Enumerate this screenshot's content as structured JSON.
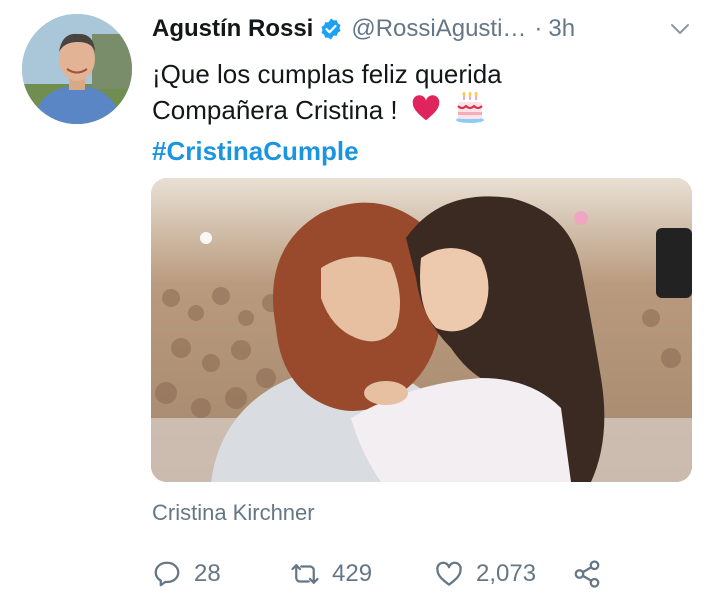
{
  "tweet": {
    "author_name": "Agustín Rossi",
    "handle": "@RossiAgusti…",
    "separator": "·",
    "time": "3h",
    "text_line1": "¡Que los cumplas feliz querida",
    "text_line2": "Compañera Cristina !",
    "hashtag": "#CristinaCumple",
    "media_source": "Cristina Kirchner"
  },
  "actions": {
    "replies": "28",
    "retweets": "429",
    "likes": "2,073"
  },
  "icons": {
    "verified": "verified-badge-icon",
    "caret": "chevron-down-icon",
    "reply": "reply-icon",
    "retweet": "retweet-icon",
    "like": "heart-icon",
    "share": "share-icon",
    "heart_emoji": "red-heart-emoji",
    "cake_emoji": "birthday-cake-emoji"
  },
  "colors": {
    "link_blue": "#1b95e0",
    "verified_blue": "#1da1f2",
    "muted_gray": "#657786",
    "heart_red": "#e0245e"
  }
}
